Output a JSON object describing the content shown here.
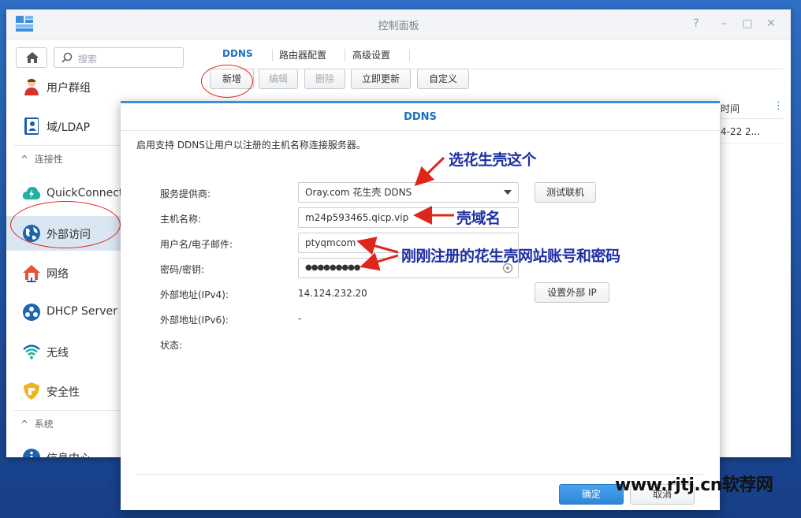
{
  "window": {
    "title": "控制面板",
    "controls": [
      "?",
      "–",
      "□",
      "✕"
    ]
  },
  "sidebar": {
    "search_placeholder": "搜索",
    "items": [
      {
        "label": "用户群组"
      },
      {
        "label": "域/LDAP"
      },
      {
        "label": "QuickConnect"
      },
      {
        "label": "外部访问"
      },
      {
        "label": "网络"
      },
      {
        "label": "DHCP Server"
      },
      {
        "label": "无线"
      },
      {
        "label": "安全性"
      },
      {
        "label": "信息中心"
      }
    ],
    "sections": [
      "连接性",
      "系统"
    ]
  },
  "tabs": [
    "DDNS",
    "路由器配置",
    "高级设置"
  ],
  "toolbar": {
    "add_label": "新增",
    "edit_label": "编辑",
    "delete_label": "删除",
    "update_label": "立即更新",
    "custom_label": "自定义"
  },
  "grid": {
    "column_time": "时间",
    "row_time": "4-22 2..."
  },
  "dialog": {
    "title": "DDNS",
    "description": "启用支持 DDNS让用户以注册的主机名称连接服务器。",
    "fields": {
      "provider_label": "服务提供商:",
      "provider_value": "Oray.com 花生壳 DDNS",
      "hostname_label": "主机名称:",
      "hostname_value": "m24p593465.qicp.vip",
      "username_label": "用户名/电子邮件:",
      "username_value": "ptyqmcom",
      "password_label": "密码/密钥:",
      "password_value": "●●●●●●●●●",
      "ipv4_label": "外部地址(IPv4):",
      "ipv4_value": "14.124.232.20",
      "ipv6_label": "外部地址(IPv6):",
      "ipv6_value": "-",
      "status_label": "状态:"
    },
    "test_button": "测试联机",
    "set_ip_button": "设置外部 IP",
    "ok_button": "确定",
    "cancel_button": "取消"
  },
  "annotations": {
    "provider_note": "选花生壳这个",
    "hostname_note": "壳域名",
    "account_note": "刚刚注册的花生壳网站账号和密码"
  },
  "watermark": "www.rjtj.cn软荐网"
}
